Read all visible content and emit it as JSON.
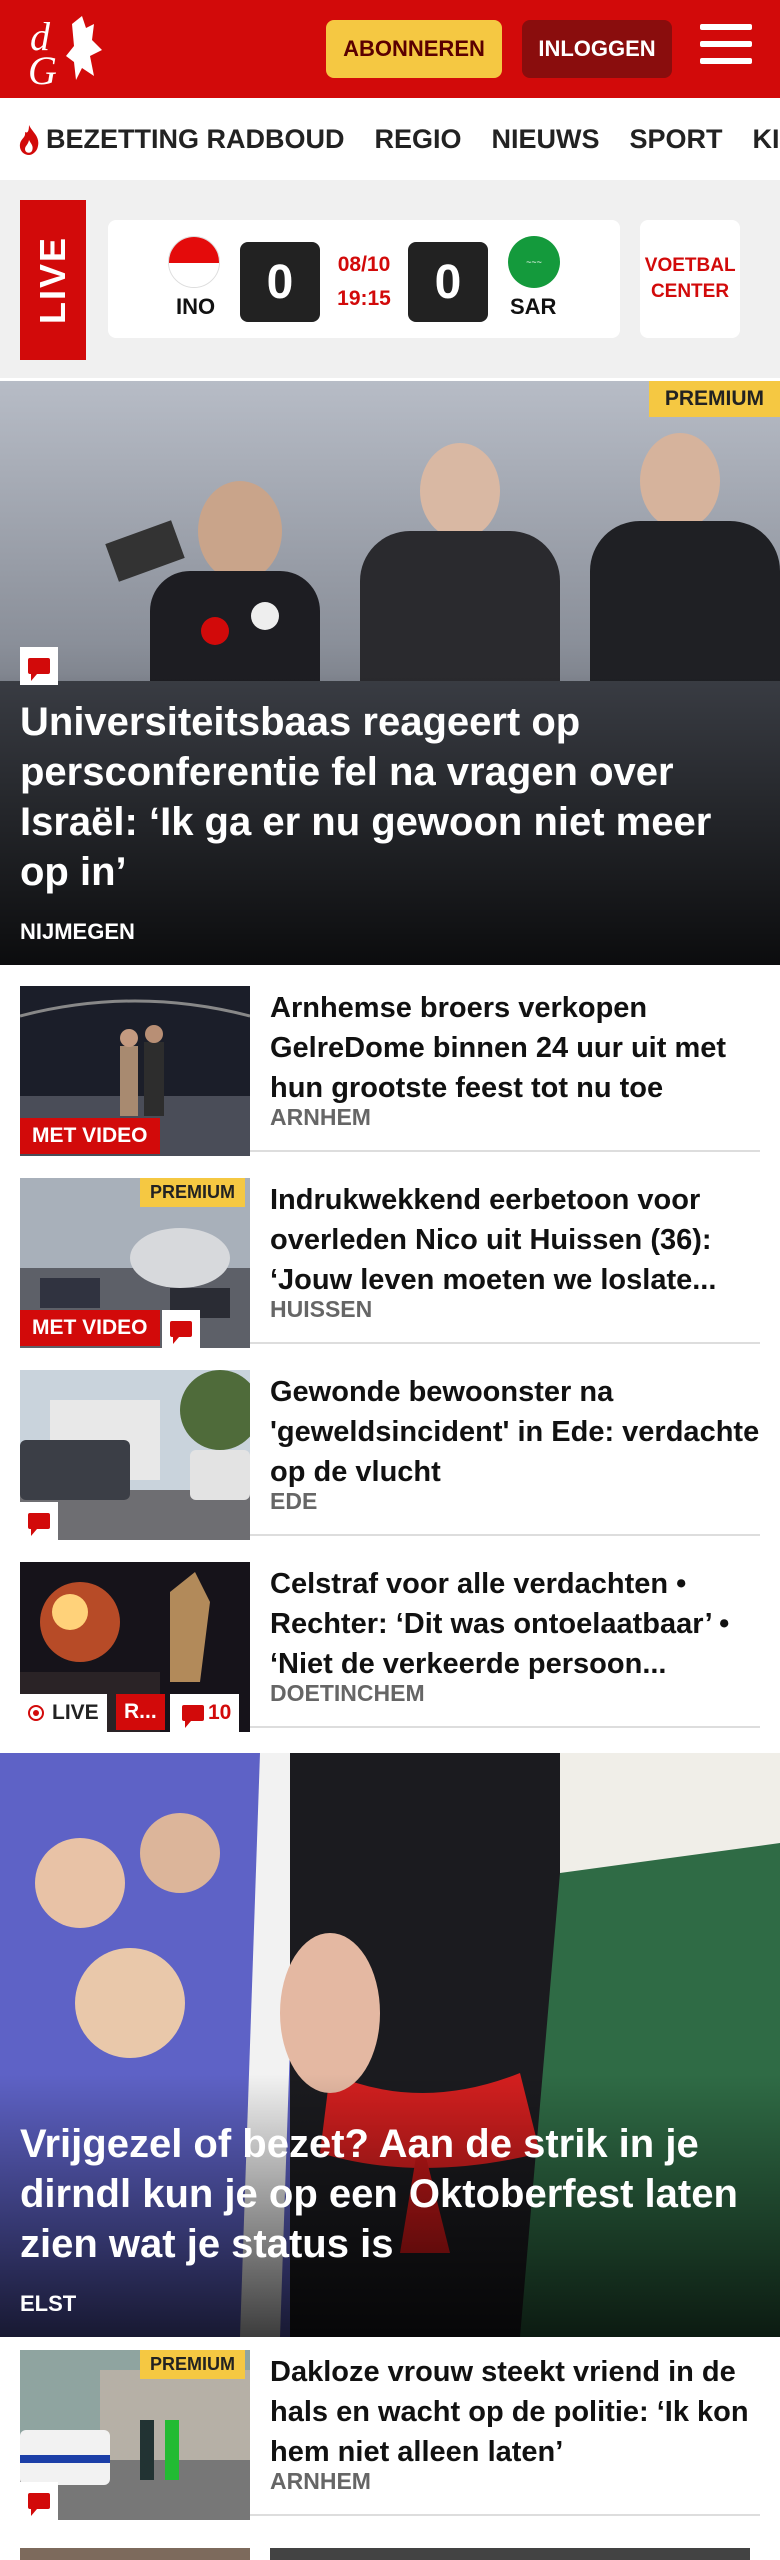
{
  "header": {
    "subscribe_label": "ABONNEREN",
    "login_label": "INLOGGEN"
  },
  "nav": {
    "items": [
      "BEZETTING RADBOUD",
      "REGIO",
      "NIEUWS",
      "SPORT",
      "KIJK"
    ]
  },
  "live": {
    "label": "LIVE",
    "match": {
      "home": "INO",
      "away": "SAR",
      "home_score": "0",
      "away_score": "0",
      "date": "08/10",
      "time": "19:15"
    },
    "center_label": "VOETBAL CENTER"
  },
  "hero": {
    "badge": "PREMIUM",
    "title": "Universiteitsbaas reageert op persconferentie fel na vragen over Israël: ‘Ik ga er nu gewoon niet meer op in’",
    "location": "NIJMEGEN"
  },
  "articles": [
    {
      "title": "Arnhemse broers verkopen GelreDome binnen 24 uur uit met hun grootste feest tot nu toe",
      "location": "ARNHEM",
      "tag": "MET VIDEO"
    },
    {
      "title": "Indrukwekkend eerbetoon voor overleden Nico uit Huissen (36): ‘Jouw leven moeten we loslate...",
      "location": "HUISSEN",
      "tag": "MET VIDEO",
      "badge": "PREMIUM"
    },
    {
      "title": "Gewonde bewoonster na 'geweldsincident' in Ede: verdachte op de vlucht",
      "location": "EDE"
    },
    {
      "title": "Celstraf voor alle verdachten • Rechter: ‘Dit was ontoelaatbaar’ • ‘Niet de verkeerde persoon...",
      "location": "DOETINCHEM",
      "live_label": "LIVE",
      "tag": "R...",
      "comments": "10"
    }
  ],
  "hero2": {
    "title": "Vrijgezel of bezet? Aan de strik in je dirndl kun je op een Oktoberfest laten zien wat je status is",
    "location": "ELST"
  },
  "articles2": [
    {
      "title": "Dakloze vrouw steekt vriend in de hals en wacht op de politie: ‘Ik kon hem niet alleen laten’",
      "location": "ARNHEM",
      "badge": "PREMIUM"
    }
  ],
  "colors": {
    "brand": "#d20a0a",
    "premium": "#f5c842",
    "login": "#8a0d0d"
  },
  "icons": [
    "dg-logo",
    "hamburger-icon",
    "flame-icon",
    "comment-icon",
    "live-dot-icon"
  ]
}
